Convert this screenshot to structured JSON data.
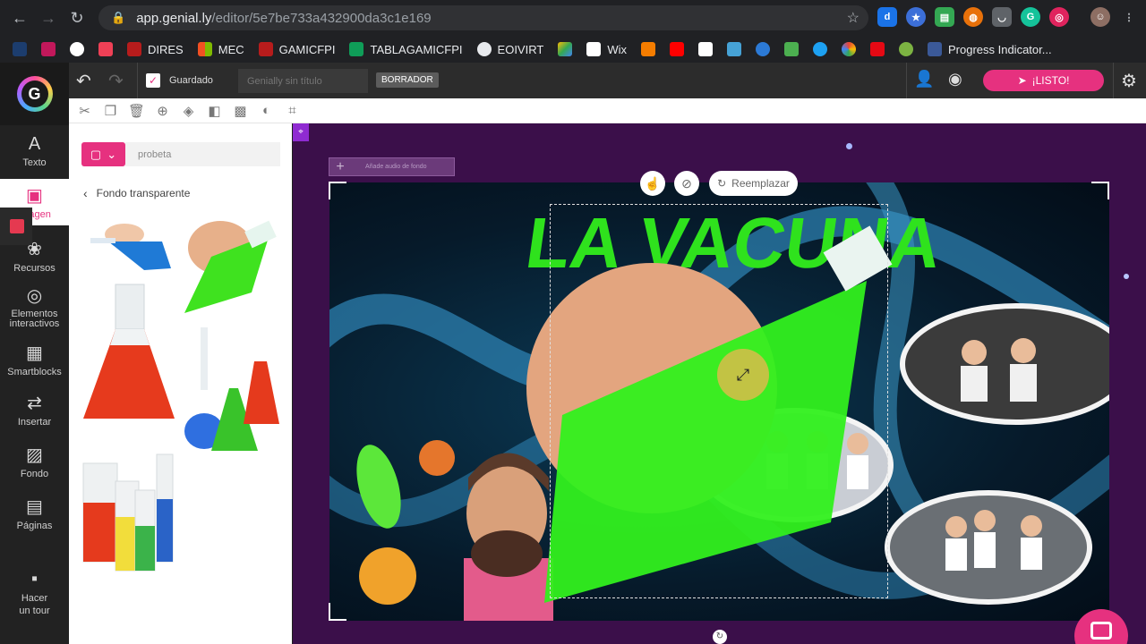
{
  "browser": {
    "url_host": "app.genial.ly",
    "url_path": "/editor/5e7be733a432900da3c1e169",
    "bookmarks": [
      "DIRES",
      "MEC",
      "GAMICFPI",
      "TABLAGAMICFPI",
      "EOIVIRT",
      "Wix",
      "Progress Indicator..."
    ],
    "colors": {
      "chrome_bg": "#202124",
      "omnibox_bg": "#303134"
    }
  },
  "topbar": {
    "saved_label": "Guardado",
    "title_placeholder": "Genially sin título",
    "draft_badge": "BORRADOR",
    "ready_button": "¡LISTO!",
    "colors": {
      "ready_bg": "#e6317f"
    }
  },
  "rail": {
    "items": [
      {
        "label": "Texto",
        "icon": "text-icon"
      },
      {
        "label": "Imagen",
        "icon": "image-icon"
      },
      {
        "label": "Recursos",
        "icon": "resources-icon"
      },
      {
        "label": "Elementos interactivos",
        "icon": "interactive-icon"
      },
      {
        "label": "Smartblocks",
        "icon": "smartblocks-icon"
      },
      {
        "label": "Insertar",
        "icon": "insert-icon"
      },
      {
        "label": "Fondo",
        "icon": "background-icon"
      },
      {
        "label": "Páginas",
        "icon": "pages-icon"
      },
      {
        "label": "Hacer un tour",
        "icon": "tour-icon"
      }
    ]
  },
  "panel": {
    "search_value": "probeta",
    "back_label": "Fondo transparente"
  },
  "canvas": {
    "audio_label": "Añade audio de fondo",
    "replace_label": "Reemplazar",
    "slide_title": "LA VACUNA"
  }
}
